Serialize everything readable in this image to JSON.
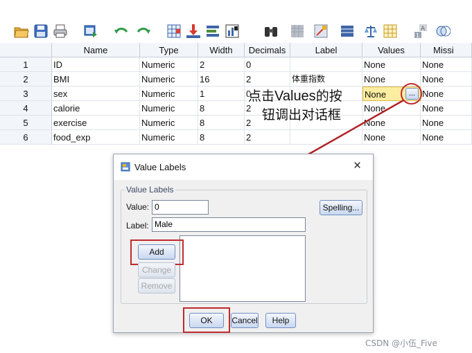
{
  "toolbar": {
    "icons": [
      "open-icon",
      "save-icon",
      "print-icon",
      "dialog-recall-icon",
      "undo-icon",
      "redo-icon",
      "goto-case-icon",
      "goto-variable-icon",
      "variables-icon",
      "run-descriptives-icon",
      "find-icon",
      "insert-cases-icon",
      "insert-variable-icon",
      "split-file-icon",
      "weight-cases-icon",
      "select-cases-icon",
      "value-labels-icon",
      "use-variable-sets-icon"
    ]
  },
  "grid": {
    "columns": [
      "Name",
      "Type",
      "Width",
      "Decimals",
      "Label",
      "Values",
      "Missi"
    ],
    "rows": [
      {
        "num": "1",
        "name": "ID",
        "type": "Numeric",
        "width": "2",
        "decimals": "0",
        "label": "",
        "values": "None",
        "missing": "None"
      },
      {
        "num": "2",
        "name": "BMI",
        "type": "Numeric",
        "width": "16",
        "decimals": "2",
        "label": "体重指数",
        "values": "None",
        "missing": "None"
      },
      {
        "num": "3",
        "name": "sex",
        "type": "Numeric",
        "width": "1",
        "decimals": "0",
        "label": "",
        "values": "None",
        "missing": "None"
      },
      {
        "num": "4",
        "name": "calorie",
        "type": "Numeric",
        "width": "8",
        "decimals": "2",
        "label": "",
        "values": "None",
        "missing": "None"
      },
      {
        "num": "5",
        "name": "exercise",
        "type": "Numeric",
        "width": "8",
        "decimals": "2",
        "label": "",
        "values": "None",
        "missing": "None"
      },
      {
        "num": "6",
        "name": "food_exp",
        "type": "Numeric",
        "width": "8",
        "decimals": "2",
        "label": "",
        "values": "None",
        "missing": "None"
      }
    ],
    "ellipsis_button": "..."
  },
  "annotation": {
    "line1_prefix": "点击",
    "line1_word": "Values",
    "line1_suffix": "的按",
    "line2": "钮调出对话框"
  },
  "dialog": {
    "title": "Value Labels",
    "close": "×",
    "group_title": "Value Labels",
    "value_label": "Value:",
    "value": "0",
    "label_label": "Label:",
    "label_value": "Male",
    "spelling": "Spelling...",
    "add": "Add",
    "change": "Change",
    "remove": "Remove",
    "ok": "OK",
    "cancel": "Cancel",
    "help": "Help"
  },
  "watermark": "CSDN @小伍_Five",
  "colors": {
    "highlight_red": "#c0292b",
    "selected_cell": "#fdeda0",
    "header_bg": "#f2f5fa",
    "button_blue": "#6f8fc0"
  }
}
